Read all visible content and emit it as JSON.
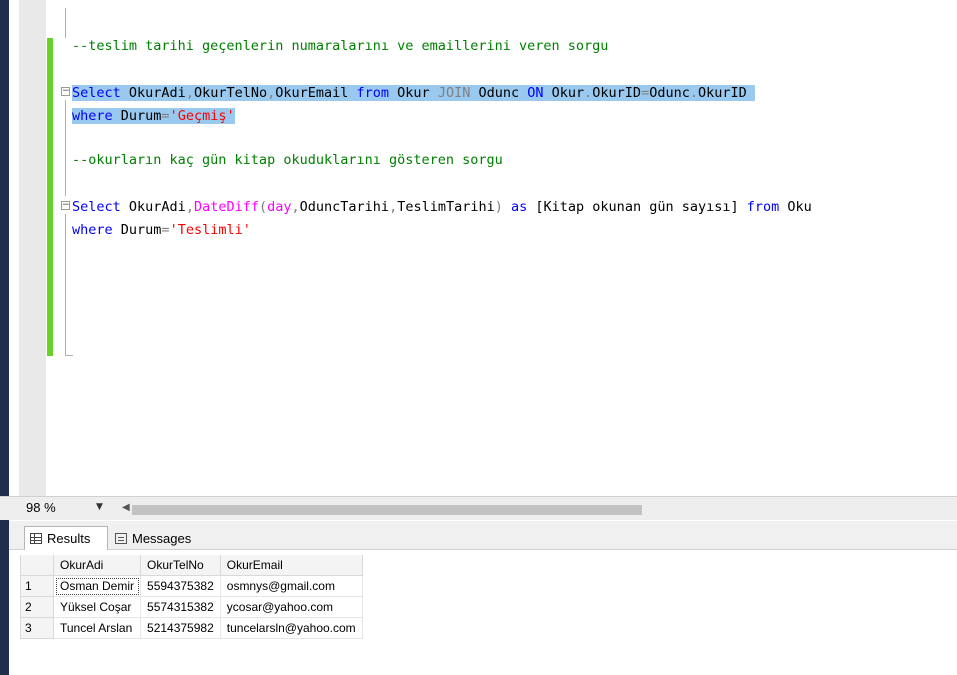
{
  "editor": {
    "lines": {
      "comment1": "--teslim tarihi geçenlerin numaralarını ve emaillerini veren sorgu",
      "q1_l1": {
        "t1": "Select",
        "t2": " OkurAdi",
        "t3": ",",
        "t4": "OkurTelNo",
        "t5": ",",
        "t6": "OkurEmail ",
        "t7": "from",
        "t8": " Okur ",
        "t9": "JOIN",
        "t10": " Odunc ",
        "t11": "ON",
        "t12": " Okur",
        "t13": ".",
        "t14": "OkurID",
        "t15": "=",
        "t16": "Odunc",
        "t17": ".",
        "t18": "OkurID"
      },
      "q1_l2": {
        "t1": "where",
        "t2": " Durum",
        "t3": "=",
        "t4": "'Geçmiş'"
      },
      "comment2": "--okurların kaç gün kitap okuduklarını gösteren sorgu",
      "q2_l1": {
        "t1": "Select",
        "t2": " OkurAdi",
        "t3": ",",
        "t4": "DateDiff",
        "t5": "(",
        "t6": "day",
        "t7": ",",
        "t8": "OduncTarihi",
        "t9": ",",
        "t10": "TeslimTarihi",
        "t11": ") ",
        "t12": "as",
        "t13": " [Kitap okunan gün sayısı] ",
        "t14": "from",
        "t15": " Oku"
      },
      "q2_l2": {
        "t1": "where",
        "t2": " Durum",
        "t3": "=",
        "t4": "'Teslimli'"
      }
    }
  },
  "zoom": "98 %",
  "tabs": {
    "results": "Results",
    "messages": "Messages"
  },
  "grid": {
    "columns": [
      "OkurAdi",
      "OkurTelNo",
      "OkurEmail"
    ],
    "rows": [
      {
        "num": "1",
        "OkurAdi": "Osman Demir",
        "OkurTelNo": "5594375382",
        "OkurEmail": "osmnys@gmail.com"
      },
      {
        "num": "2",
        "OkurAdi": "Yüksel Coşar",
        "OkurTelNo": "5574315382",
        "OkurEmail": "ycosar@yahoo.com"
      },
      {
        "num": "3",
        "OkurAdi": "Tuncel Arslan",
        "OkurTelNo": "5214375982",
        "OkurEmail": "tuncelarsln@yahoo.com"
      }
    ]
  },
  "colors": {
    "comment": "#008000",
    "keyword": "#0000ff",
    "function": "#ff00ff",
    "string": "#ff0000",
    "selection": "#99c9ef",
    "change_bar": "#67d12b"
  }
}
